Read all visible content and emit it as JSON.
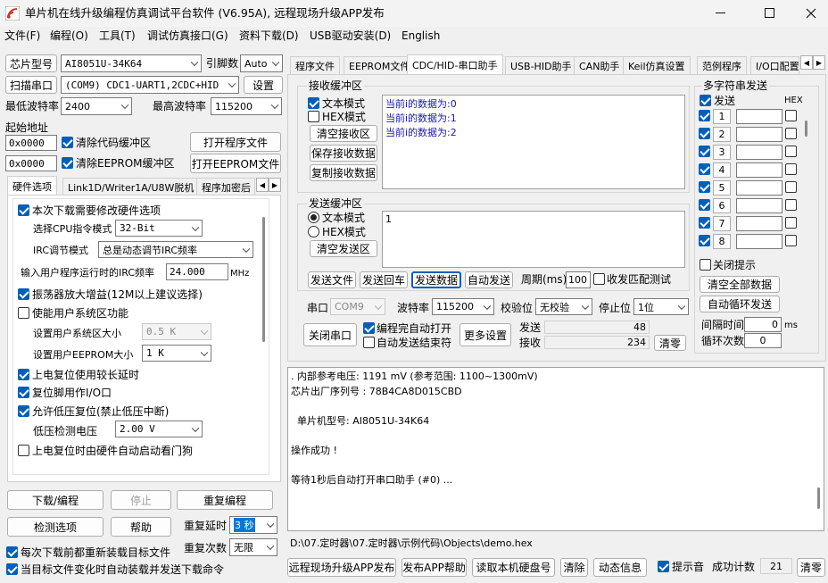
{
  "window": {
    "title": "单片机在线升级编程仿真调试平台软件 (V6.95A), 远程现场升级APP发布"
  },
  "menu": [
    "文件(F)",
    "编程(O)",
    "工具(T)",
    "调试仿真接口(G)",
    "资料下载(D)",
    "USB驱动安装(D)",
    "English"
  ],
  "left": {
    "chip_label": "芯片型号",
    "chip_value": "AI8051U-34K64",
    "pins_label": "引脚数",
    "pins_value": "Auto",
    "scan_btn": "扫描串口",
    "port_value": "(COM9) CDC1-UART1,2CDC+HID",
    "settings_btn": "设置",
    "min_baud_label": "最低波特率",
    "min_baud": "2400",
    "max_baud_label": "最高波特率",
    "max_baud": "115200",
    "start_addr_label": "起始地址",
    "addr1": "0x0000",
    "clear_code": "清除代码缓冲区",
    "open_prog": "打开程序文件",
    "addr2": "0x0000",
    "clear_eeprom": "清除EEPROM缓冲区",
    "open_eeprom": "打开EEPROM文件",
    "tabs": [
      "硬件选项",
      "Link1D/Writer1A/U8W脱机",
      "程序加密后"
    ],
    "hw": {
      "opt1": "本次下载需要修改硬件选项",
      "cpu_label": "选择CPU指令模式",
      "cpu_value": "32-Bit",
      "irc_label": "IRC调节模式",
      "irc_value": "总是动态调节IRC频率",
      "freq_label": "输入用户程序运行时的IRC频率",
      "freq_value": "24.000",
      "freq_unit": "MHz",
      "opt2": "振荡器放大增益(12M以上建议选择)",
      "opt3": "使能用户系统区功能",
      "sys_label": "设置用户系统区大小",
      "sys_value": "0.5 K",
      "eep_label": "设置用户EEPROM大小",
      "eep_value": "1   K",
      "opt4": "上电复位使用较长延时",
      "opt5": "复位脚用作I/O口",
      "opt6": "允许低压复位(禁止低压中断)",
      "lv_label": "低压检测电压",
      "lv_value": "2.00 V",
      "opt7": "上电复位时由硬件自动启动看门狗"
    },
    "download_btn": "下载/编程",
    "stop_btn": "停止",
    "reprog_btn": "重复编程",
    "detect_btn": "检测选项",
    "help_btn": "帮助",
    "delay_label": "重复延时",
    "delay_value": "3 秒",
    "count_label": "重复次数",
    "count_value": "无限",
    "reload": "每次下载前都重新装载目标文件",
    "autoload": "当目标文件变化时自动装载并发送下载命令"
  },
  "right": {
    "tabs": [
      "程序文件",
      "EEPROM文件",
      "CDC/HID-串口助手",
      "USB-HID助手",
      "CAN助手",
      "Keil仿真设置",
      "范例程序",
      "I/O口配置"
    ],
    "recv_title": "接收缓冲区",
    "text_mode": "文本模式",
    "hex_mode": "HEX模式",
    "clear_recv": "清空接收区",
    "save_recv": "保存接收数据",
    "copy_recv": "复制接收数据",
    "recv_lines": [
      "当前i的数据为:0",
      "当前i的数据为:1",
      "当前i的数据为:2"
    ],
    "send_title": "发送缓冲区",
    "send_text_mode": "文本模式",
    "send_hex_mode": "HEX模式",
    "clear_send": "清空发送区",
    "send_content": "1",
    "send_file": "发送文件",
    "send_cr": "发送回车",
    "send_data": "发送数据",
    "auto_send": "自动发送",
    "period_label": "周期(ms)",
    "period_value": "100",
    "match_label": "收发匹配测试",
    "multi_title": "多字符串发送",
    "send_col": "发送",
    "hex_col": "HEX",
    "multi_rows": [
      "1",
      "2",
      "3",
      "4",
      "5",
      "6",
      "7",
      "8"
    ],
    "close_hint": "关闭提示",
    "clear_all": "清空全部数据",
    "auto_loop": "自动循环发送",
    "interval_label": "间隔时间",
    "interval_value": "0",
    "interval_unit": "ms",
    "loop_label": "循环次数",
    "loop_value": "0",
    "port_label": "串口",
    "port_value": "COM9",
    "baud_label": "波特率",
    "baud_value": "115200",
    "parity_label": "校验位",
    "parity_value": "无校验",
    "stop_label": "停止位",
    "stop_value": "1位",
    "close_port": "关闭串口",
    "auto_open": "编程完自动打开",
    "auto_end": "自动发送结束符",
    "more_settings": "更多设置",
    "sent_label": "发送",
    "sent_value": "48",
    "recv_label": "接收",
    "recv_value": "234",
    "clear_counts": "清零"
  },
  "log": {
    "lines": [
      ". 内部参考电压: 1191 mV (参考范围: 1100~1300mV)",
      "芯片出厂序列号 : 78B4CA8D015CBD",
      "",
      "  单片机型号: AI8051U-34K64",
      "",
      "操作成功 !",
      "",
      "等待1秒后自动打开串口助手 (#0) ..."
    ]
  },
  "path": "D:\\07.定时器\\07.定时器\\示例代码\\Objects\\demo.hex",
  "bottom": {
    "remote_btn": "远程现场升级APP发布",
    "publish_btn": "发布APP帮助",
    "read_btn": "读取本机硬盘号",
    "clear_btn": "清除",
    "anim_btn": "动态信息",
    "beep_label": "提示音",
    "success_label": "成功计数",
    "success_value": "21",
    "zero_btn": "清零"
  },
  "colors": {
    "accent": "#005fb8",
    "recv_text": "#1a1ab0"
  }
}
